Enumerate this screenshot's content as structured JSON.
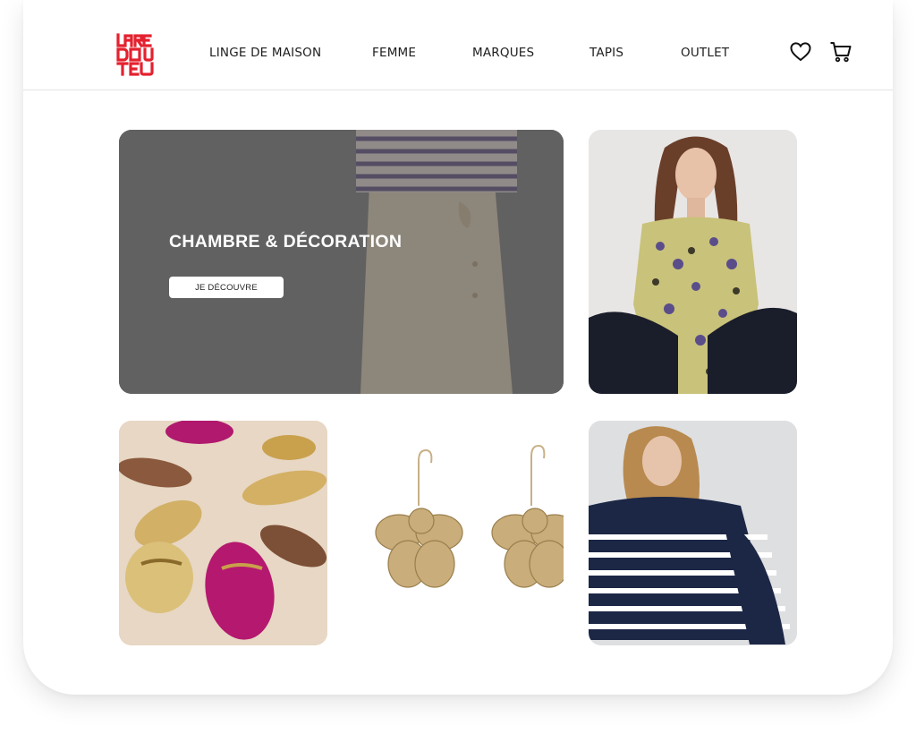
{
  "brand": {
    "name": "LA REDOUTE",
    "color": "#e4212f"
  },
  "nav": {
    "items": [
      {
        "label": "LINGE DE MAISON"
      },
      {
        "label": "FEMME"
      },
      {
        "label": "MARQUES"
      },
      {
        "label": "TAPIS"
      },
      {
        "label": "OUTLET"
      }
    ]
  },
  "header_icons": {
    "wishlist": "heart-icon",
    "cart": "cart-icon"
  },
  "hero": {
    "title": "CHAMBRE & DÉCORATION",
    "button_label": "JE DÉCOUVRE"
  },
  "tiles": [
    {
      "image": "woman-in-leopard-print-blouse-photo"
    },
    {
      "image": "loafers-photo"
    },
    {
      "image": "flower-earrings-photo"
    },
    {
      "image": "woman-in-striped-sweater-photo"
    }
  ]
}
